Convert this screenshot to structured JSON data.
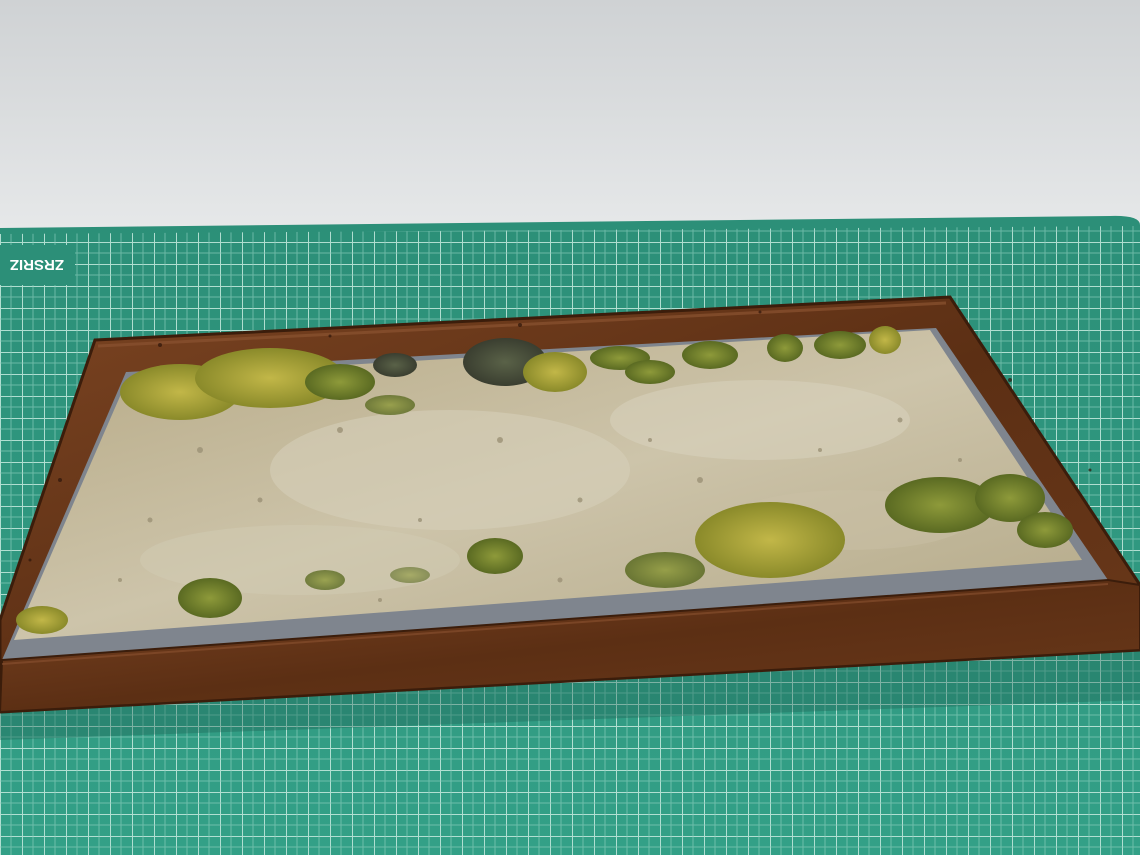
{
  "scene": {
    "subject": "framed-diorama-base",
    "colors": {
      "wall_top": "#cfd2d4",
      "wall_bottom": "#e4e6e7",
      "mat_green": "#2f9a82",
      "mat_grid_line": "#b8e2d6",
      "frame_wood": "#6a3a1c",
      "frame_wood_dark": "#3e1f0c",
      "plinth_gray": "#7e848d",
      "ground_sand": "#bfb496",
      "grass_yellow": "#a8a23a",
      "grass_green": "#6f7a2a"
    }
  },
  "mat_logo": {
    "text": "ZRSRIZ"
  }
}
